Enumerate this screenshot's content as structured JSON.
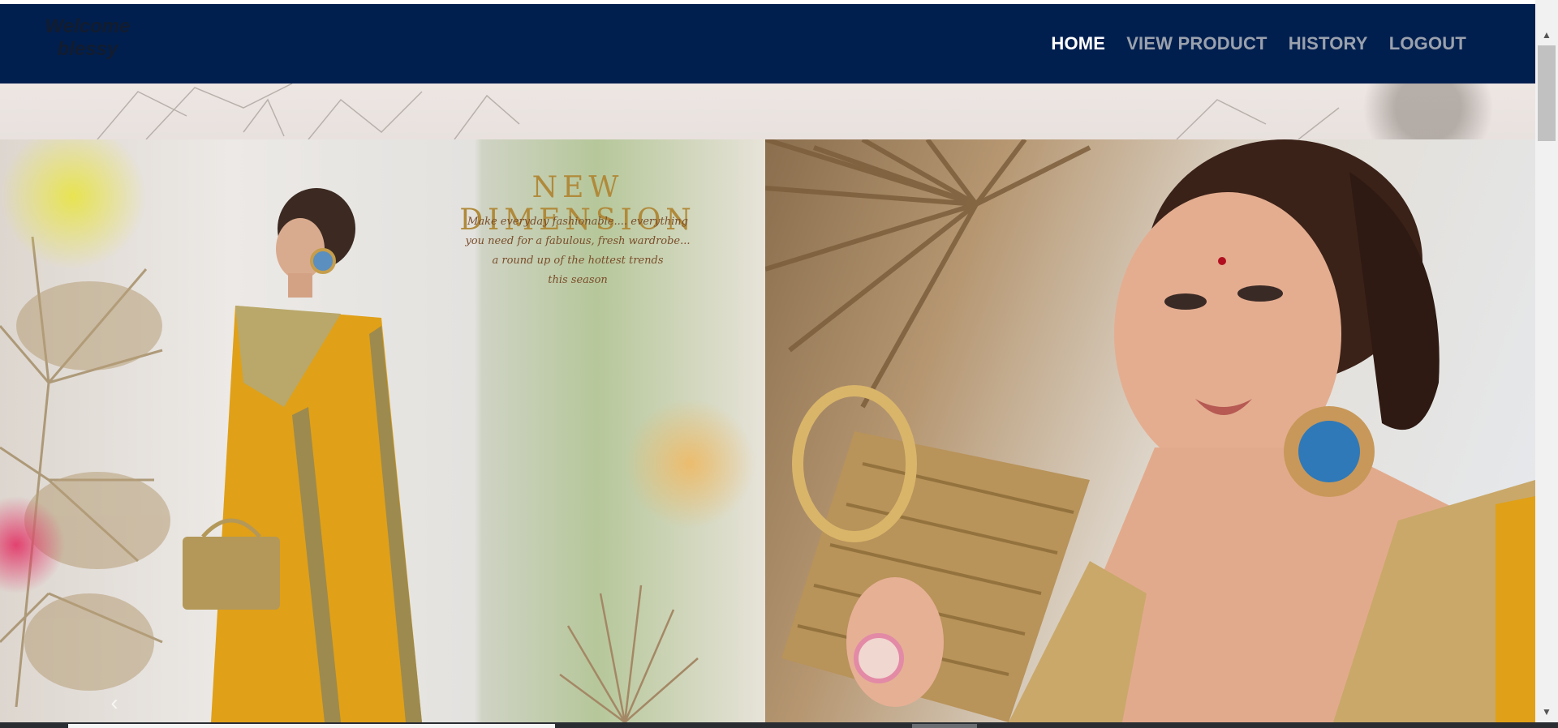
{
  "navbar": {
    "welcome_line1": "Welcome",
    "welcome_line2": "blessy",
    "links": [
      {
        "label": "HOME",
        "active": true
      },
      {
        "label": "VIEW PRODUCT",
        "active": false
      },
      {
        "label": "HISTORY",
        "active": false
      },
      {
        "label": "LOGOUT",
        "active": false
      }
    ],
    "background_color": "#001f4f"
  },
  "hero": {
    "headline": "NEW DIMENSION",
    "tagline_lines": [
      "Make everyday fashionable.... everything",
      "you need for a fabulous, fresh wardrobe...",
      "a round up of the hottest trends",
      "this season"
    ],
    "prev_icon": "chevron-left-icon"
  },
  "scrollbar": {
    "up_icon": "triangle-up-icon",
    "down_icon": "triangle-down-icon"
  }
}
